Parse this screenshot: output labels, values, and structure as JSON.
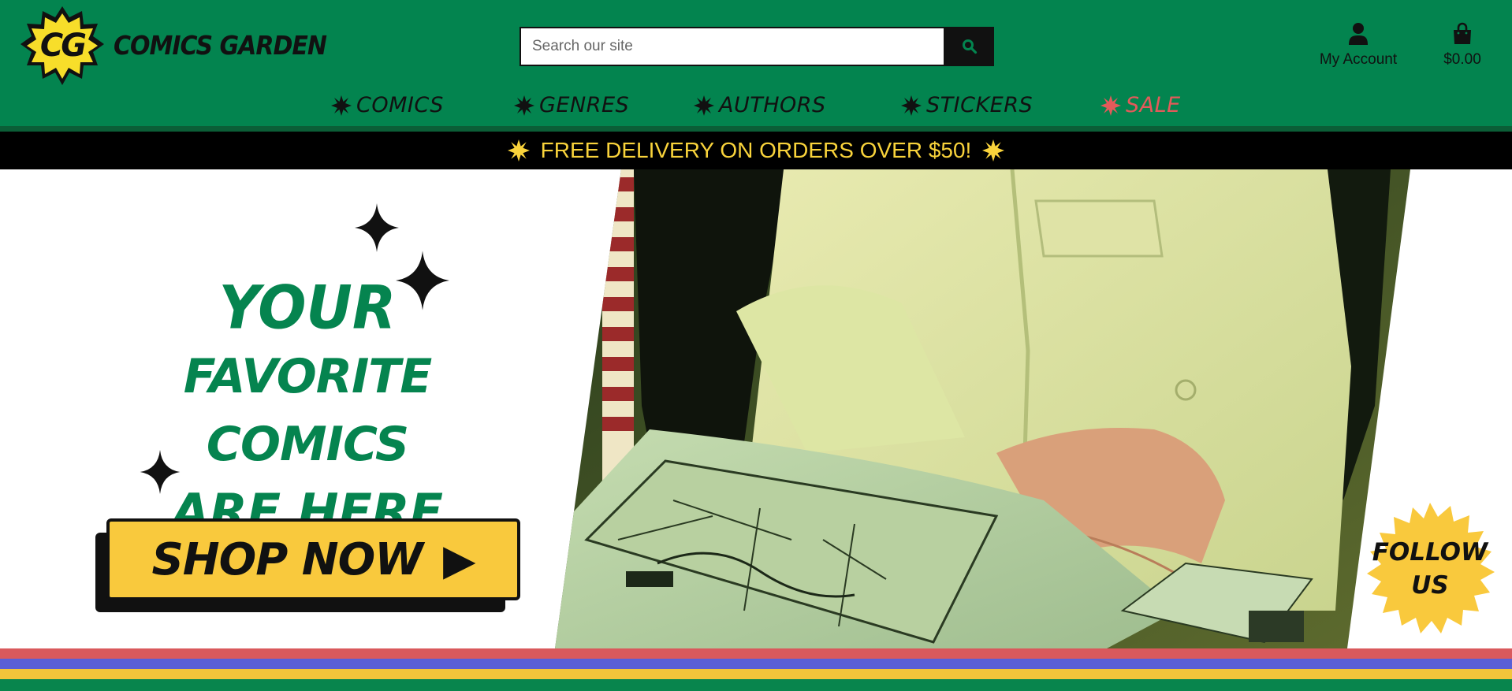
{
  "brand": {
    "logo_initials": "CG",
    "name": "COMICS GARDEN"
  },
  "search": {
    "placeholder": "Search our site",
    "button_icon": "search-icon"
  },
  "account": {
    "label": "My Account",
    "icon": "user-icon"
  },
  "cart": {
    "label": "$0.00",
    "icon": "shopping-bag-icon"
  },
  "nav": {
    "items": [
      {
        "label": "COMICS"
      },
      {
        "label": "GENRES"
      },
      {
        "label": "AUTHORS"
      },
      {
        "label": "STICKERS"
      },
      {
        "label": "SALE"
      }
    ]
  },
  "promo": {
    "text": "FREE DELIVERY ON ORDERS OVER $50!"
  },
  "hero": {
    "headline_line1": "YOUR",
    "headline_line2": "FAVORITE COMICS",
    "headline_line3": "ARE HERE",
    "cta_label": "SHOP NOW",
    "cta_arrow": "▶",
    "follow_label_line1": "FOLLOW",
    "follow_label_line2": "US"
  },
  "colors": {
    "header_green": "#03844f",
    "accent_yellow": "#f9c93d",
    "promo_yellow": "#f9d33b",
    "sale_red": "#e35a5a",
    "stripe_red": "#d9595c",
    "stripe_blue": "#5a5fd6",
    "stripe_yellow": "#f2c43a",
    "stripe_green": "#08854d"
  }
}
